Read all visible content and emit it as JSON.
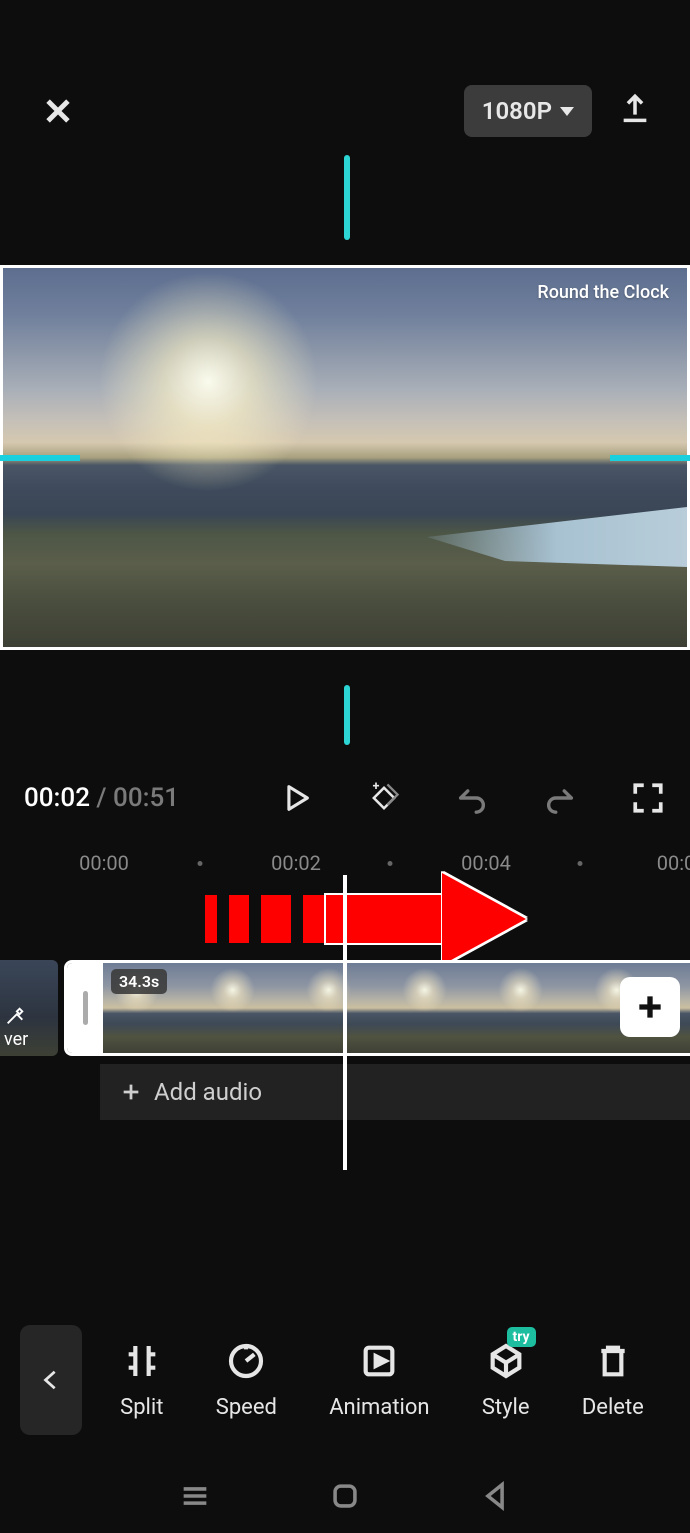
{
  "top": {
    "resolution_label": "1080P"
  },
  "preview": {
    "watermark": "Round the Clock"
  },
  "playback": {
    "current": "00:02",
    "separator": " / ",
    "total": "00:51"
  },
  "ruler": {
    "t0": "00:00",
    "t1": "00:02",
    "t2": "00:04",
    "t3": "00:0"
  },
  "clip": {
    "duration_badge": "34.3s",
    "cover_label": "ver"
  },
  "audio": {
    "add_label": "Add audio"
  },
  "tools": {
    "split": "Split",
    "speed": "Speed",
    "animation": "Animation",
    "style": "Style",
    "delete": "Delete",
    "try_badge": "try"
  }
}
